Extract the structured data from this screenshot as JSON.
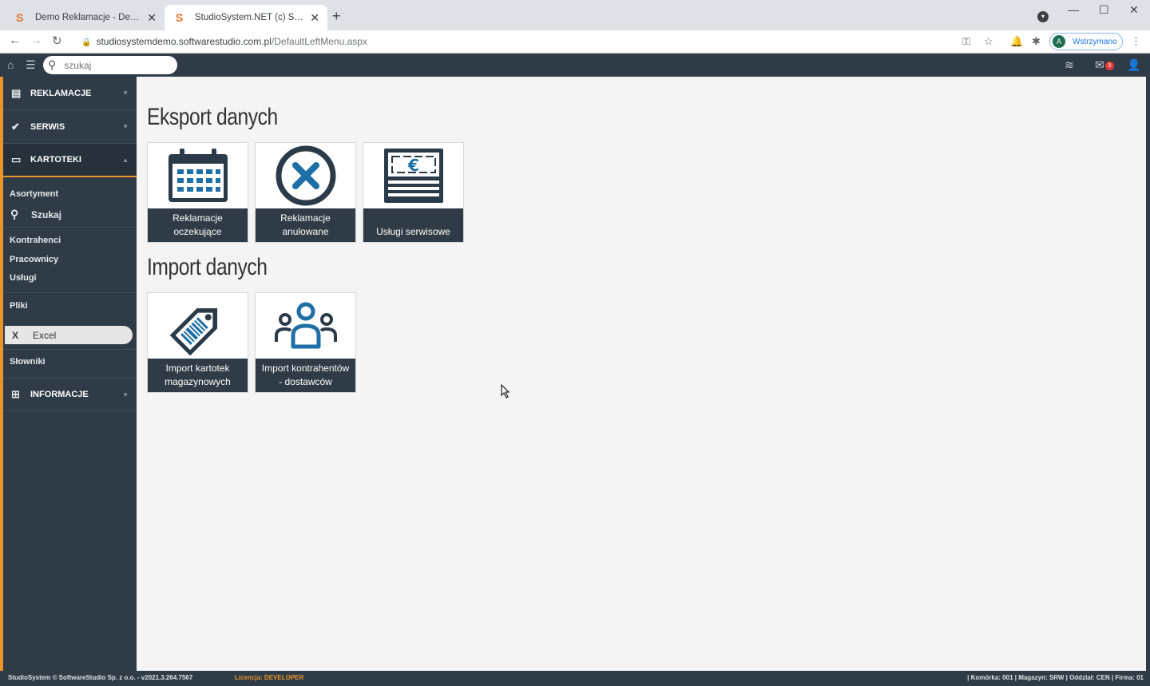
{
  "browser": {
    "tabs": [
      {
        "title": "Demo Reklamacje - Demo on line",
        "favicon": "S"
      },
      {
        "title": "StudioSystem.NET (c) SoftwareStudio",
        "favicon": "S"
      }
    ],
    "url_host": "studiosystemdemo.softwarestudio.com.pl",
    "url_path": "/DefaultLeftMenu.aspx",
    "profile_initial": "A",
    "profile_status": "Wstrzymano"
  },
  "apptop": {
    "search_placeholder": "szukaj",
    "mail_count": "5"
  },
  "sidebar": {
    "sections": {
      "reklamacje": "REKLAMACJE",
      "serwis": "SERWIS",
      "kartoteki": "KARTOTEKI",
      "informacje": "INFORMACJE"
    },
    "items": {
      "asortyment": "Asortyment",
      "szukaj": "Szukaj",
      "kontrahenci": "Kontrahenci",
      "pracownicy": "Pracownicy",
      "uslugi": "Usługi",
      "pliki": "Pliki",
      "excel": "Excel",
      "slowniki": "Słowniki"
    }
  },
  "main": {
    "export_title": "Eksport danych",
    "import_title": "Import danych",
    "export_tiles": [
      {
        "line1": "Reklamacje",
        "line2": "oczekujące",
        "icon": "calendar-icon"
      },
      {
        "line1": "Reklamacje",
        "line2": "anulowane",
        "icon": "cancel-circle-icon"
      },
      {
        "line1": "Usługi serwisowe",
        "line2": "",
        "icon": "euro-document-icon"
      }
    ],
    "import_tiles": [
      {
        "line1": "Import kartotek",
        "line2": "magazynowych",
        "icon": "price-tag-icon"
      },
      {
        "line1": "Import kontrahentów",
        "line2": "- dostawców",
        "icon": "users-group-icon"
      }
    ]
  },
  "status": {
    "left": "StudioSystem © SoftwareStudio Sp. z o.o. - v2021.3.264.7567",
    "license_label": "Licencja:",
    "license_value": "DEVELOPER",
    "right": "| Komórka: 001 | Magazyn: SRW | Oddział: CEN | Firma: 01"
  },
  "colors": {
    "dark": "#2f3b47",
    "accent": "#e8952a",
    "icon_blue": "#1d6fa5",
    "icon_dark": "#2b3a48"
  }
}
